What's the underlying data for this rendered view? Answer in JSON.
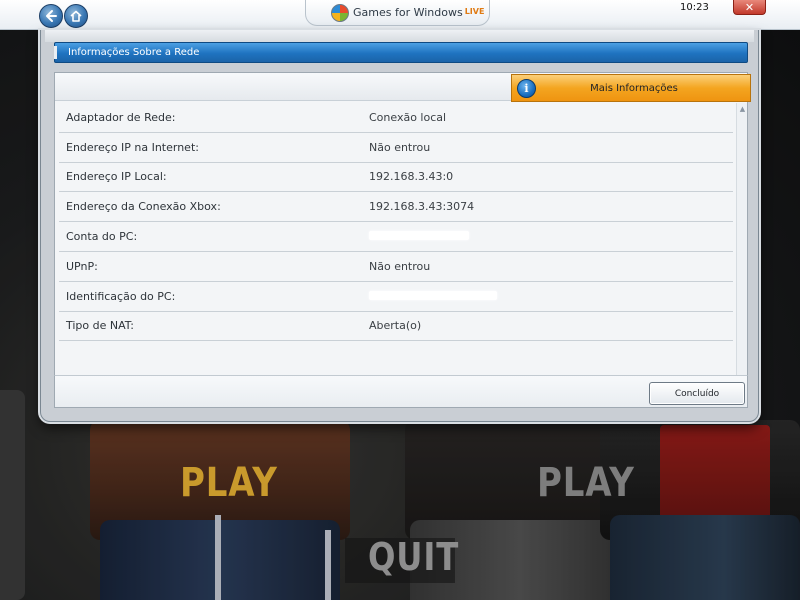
{
  "topbar": {
    "logo_text": "Games for Windows",
    "logo_live": "LIVE",
    "clock": "10:23",
    "close_glyph": "✕",
    "icons": {
      "back": "back-arrow-icon",
      "home": "home-icon",
      "logo": "windows-flag-icon"
    }
  },
  "dialog": {
    "title": "Informações Sobre a Rede",
    "more_info_label": "Mais Informações",
    "info_glyph": "i",
    "done_label": "Concluído",
    "rows": [
      {
        "label": "Adaptador de Rede:",
        "value": "Conexão local"
      },
      {
        "label": "Endereço IP na Internet:",
        "value": "Não entrou"
      },
      {
        "label": "Endereço IP Local:",
        "value": "192.168.3.43:0"
      },
      {
        "label": "Endereço da Conexão Xbox:",
        "value": "192.168.3.43:3074"
      },
      {
        "label": "Conta do PC:",
        "value": ""
      },
      {
        "label": "UPnP:",
        "value": "Não entrou"
      },
      {
        "label": "Identificação do PC:",
        "value": ""
      },
      {
        "label": "Tipo de NAT:",
        "value": "Aberta(o)"
      }
    ]
  },
  "background": {
    "play_1": "PLAY",
    "play_2": "PLAY",
    "quit": "QUIT"
  },
  "colors": {
    "header_blue": "#1f73c0",
    "more_info_orange": "#f4a520",
    "play_highlight": "#c99a2c"
  }
}
